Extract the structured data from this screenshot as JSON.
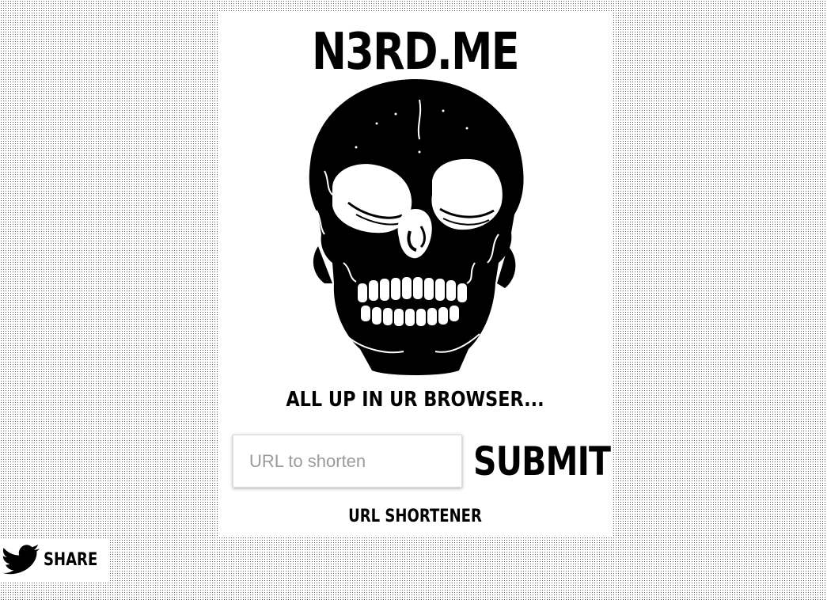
{
  "site": {
    "logo": "N3RD.ME",
    "tagline": "ALL UP IN UR BROWSER...",
    "caption": "URL SHORTENER"
  },
  "form": {
    "url_placeholder": "URL to shorten",
    "url_value": "",
    "submit_label": "SUBMIT"
  },
  "share": {
    "label": "SHARE",
    "icon": "twitter-bird-icon"
  },
  "illustration": {
    "icon": "skull-illustration"
  }
}
